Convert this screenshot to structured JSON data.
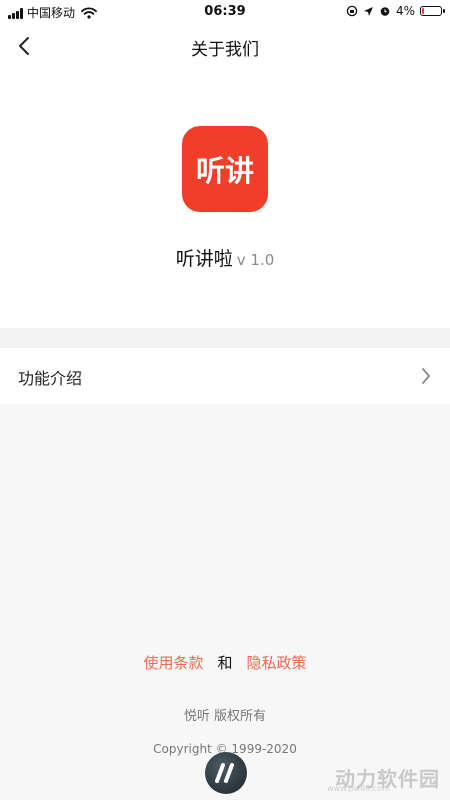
{
  "status_bar": {
    "carrier": "中国移动",
    "time": "06:39",
    "battery": "4%",
    "battery_level": 0.04
  },
  "nav": {
    "title": "关于我们",
    "back_icon": "chevron-left-icon"
  },
  "app": {
    "logo_text": "听讲",
    "logo_color": "#ef3e2a",
    "name": "听讲啦",
    "version": "v 1.0"
  },
  "menu": {
    "items": [
      {
        "label": "功能介绍",
        "icon": "chevron-right-icon"
      }
    ]
  },
  "footer": {
    "terms_link": "使用条款",
    "conjunction": "和",
    "privacy_link": "隐私政策",
    "owner": "悦听 版权所有",
    "copyright": "Copyright © 1999-2020",
    "accent_color": "#ee6a51"
  },
  "watermark": {
    "text": "动力软件园",
    "url": "www.pw88.com"
  }
}
